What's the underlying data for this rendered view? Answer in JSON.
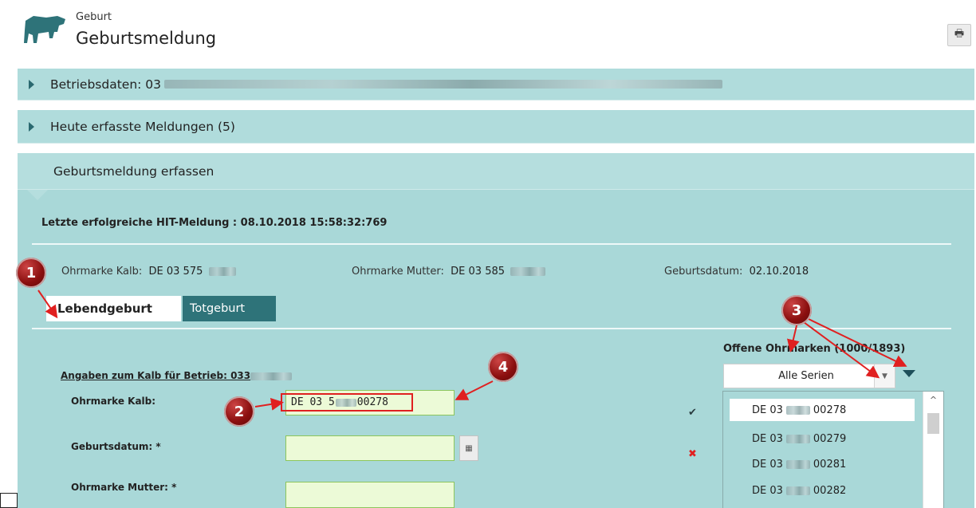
{
  "header": {
    "category": "Geburt",
    "title": "Geburtsmeldung",
    "print_icon": "print-icon"
  },
  "accordions": [
    {
      "label": "Betriebsdaten: 03",
      "expanded": false
    },
    {
      "label": "Heute erfasste Meldungen (5)",
      "expanded": false
    },
    {
      "label": "Geburtsmeldung erfassen",
      "expanded": true
    }
  ],
  "form": {
    "last_message": "Letzte erfolgreiche HIT-Meldung : 08.10.2018 15:58:32:769",
    "ear_tag_calf_label": "Ohrmarke Kalb:",
    "ear_tag_calf_value": "DE 03 575",
    "ear_tag_mother_label": "Ohrmarke Mutter:",
    "ear_tag_mother_value": "DE 03 585",
    "birth_date_label": "Geburtsdatum:",
    "birth_date_value": "02.10.2018",
    "tabs": [
      "Lebendgeburt",
      "Totgeburt"
    ],
    "section_title": "Angaben zum Kalb für Betrieb: 033",
    "fields": {
      "calf_label": "Ohrmarke Kalb:",
      "calf_value": "DE 03 5",
      "calf_value_tail": "00278",
      "birthdate_label": "Geburtsdatum: *",
      "birthdate_value": "",
      "mother_label": "Ohrmarke Mutter: *",
      "mother_value": ""
    },
    "status": {
      "calf_ok": "✔",
      "birthdate_error": "✖"
    }
  },
  "open_tags": {
    "title": "Offene Ohrmarken (1000/1893)",
    "series_select": "Alle Serien",
    "items": [
      {
        "prefix": "DE 03",
        "suffix": "00278"
      },
      {
        "prefix": "DE 03",
        "suffix": "00279"
      },
      {
        "prefix": "DE 03",
        "suffix": "00281"
      },
      {
        "prefix": "DE 03",
        "suffix": "00282"
      }
    ]
  },
  "callouts": [
    "1",
    "2",
    "3",
    "4"
  ],
  "colors": {
    "panel": "#a9d8d8",
    "accordion": "#b0dcdc",
    "tab_active": "#ffffff",
    "tab_inactive": "#2e7379",
    "input_bg": "#ecfad7",
    "callout": "#8b0f0f",
    "arrow": "#e02020"
  }
}
